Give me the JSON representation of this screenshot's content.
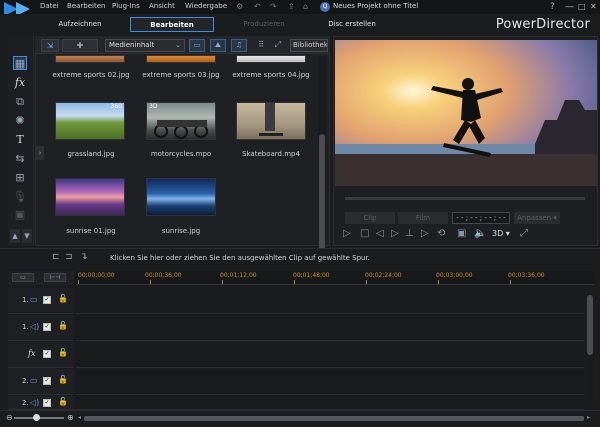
{
  "menu": {
    "items": [
      "Datei",
      "Bearbeiten",
      "Plug-Ins",
      "Ansicht",
      "Wiedergabe"
    ],
    "project_title": "Neues Projekt ohne Titel"
  },
  "window": {
    "help": "?",
    "minimize": "—",
    "maximize": "□",
    "close": "✕"
  },
  "modes": {
    "tabs": [
      {
        "label": "Aufzeichnen",
        "state": "normal"
      },
      {
        "label": "Bearbeiten",
        "state": "active"
      },
      {
        "label": "Produzieren",
        "state": "disabled"
      },
      {
        "label": "Disc erstellen",
        "state": "normal"
      }
    ],
    "brand": "PowerDirector"
  },
  "library": {
    "filter_select": "Medieninhalt",
    "category_select": "Bibliothek s",
    "top_row_captions": [
      "extreme sports 02.jpg",
      "extreme sports 03.jpg",
      "extreme sports 04.jpg"
    ],
    "items": [
      {
        "caption": "grassland.jpg",
        "badge": "360"
      },
      {
        "caption": "motorcycles.mpo",
        "badge": "3D"
      },
      {
        "caption": "Skateboard.mp4",
        "badge": ""
      },
      {
        "caption": "sunrise 01.jpg",
        "badge": ""
      },
      {
        "caption": "sunrise.jpg",
        "badge": ""
      }
    ]
  },
  "preview": {
    "clip_label": "Clip",
    "film_label": "Film",
    "timecode": "- - ; - - ; - - ; - -",
    "fit_label": "Anpassen",
    "mode_3d": "3D"
  },
  "status": {
    "hint": "Klicken Sie hier oder ziehen Sie den ausgewählten Clip auf gewählte Spur."
  },
  "timeline": {
    "ruler_labels": [
      "00;00;00;00",
      "00;00;36;00",
      "00;01;12;00",
      "00;01;48;00",
      "00;02;24;00",
      "00;03;00;00",
      "00;03;36;00"
    ],
    "tracks": [
      {
        "number": "1.",
        "icon": "video-track-icon"
      },
      {
        "number": "1.",
        "icon": "audio-track-icon"
      },
      {
        "number": "",
        "icon": "fx-track-icon"
      },
      {
        "number": "2.",
        "icon": "video-track-icon"
      },
      {
        "number": "2.",
        "icon": "audio-track-icon"
      }
    ]
  },
  "colors": {
    "accent": "#3f8fe0",
    "timecode": "#c8902a",
    "background": "#1b1c1e"
  }
}
